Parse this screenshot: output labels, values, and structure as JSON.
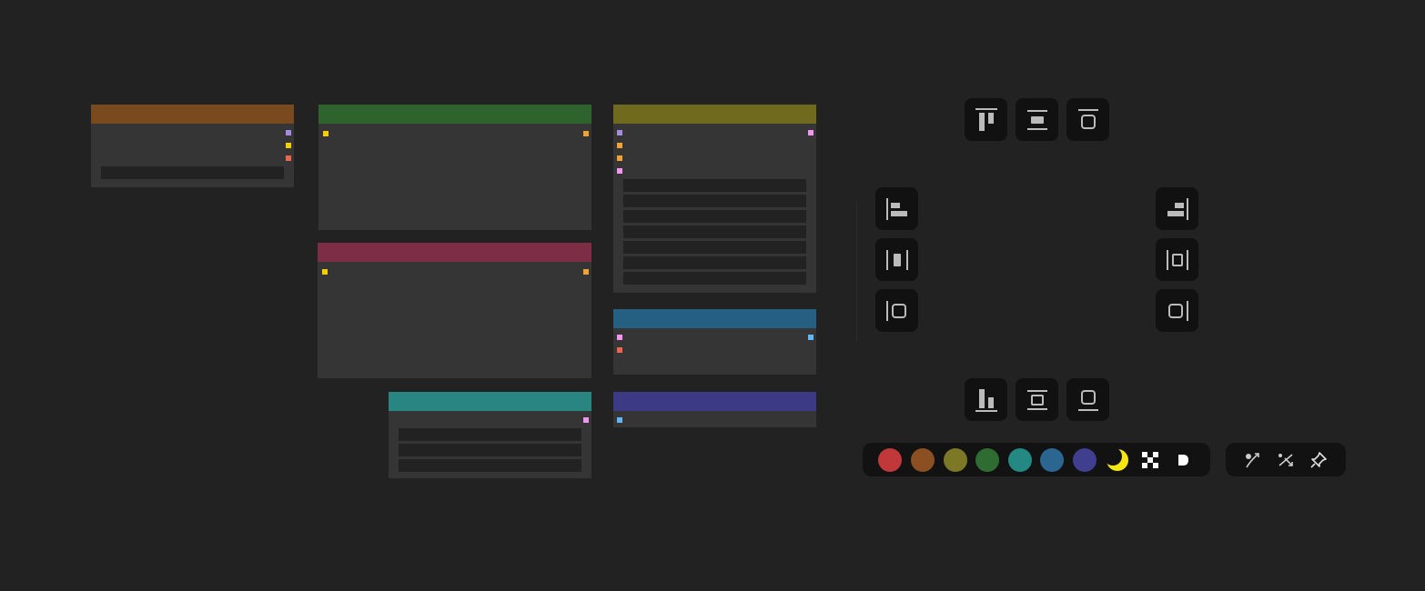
{
  "colors": {
    "background": "#222222",
    "node_body": "#353535",
    "widget": "#222222",
    "toolbar": "#111111"
  },
  "nodes": [
    {
      "name": "node-brown",
      "header_color": "#7a4a1f"
    },
    {
      "name": "node-green",
      "header_color": "#2e632d"
    },
    {
      "name": "node-red",
      "header_color": "#7e2d47"
    },
    {
      "name": "node-olive",
      "header_color": "#6f6a1e"
    },
    {
      "name": "node-blue",
      "header_color": "#255f82"
    },
    {
      "name": "node-teal",
      "header_color": "#298581"
    },
    {
      "name": "node-indigo",
      "header_color": "#3d3a85"
    }
  ],
  "slot_colors": {
    "lavender": "#a58ce0",
    "yellow": "#f5cd05",
    "orange": "#f0a232",
    "salmon": "#ea6650",
    "pink": "#f295f0",
    "skyblue": "#64b5f6"
  },
  "align_toolbar": {
    "top": [
      "align-top-icon",
      "align-vertical-center-icon",
      "align-top-edge-icon"
    ],
    "left": [
      "align-left-icon",
      "distribute-horizontal-icon",
      "align-left-edge-icon"
    ],
    "right": [
      "align-right-icon",
      "distribute-horizontal-alt-icon",
      "align-right-edge-icon"
    ],
    "bottom": [
      "align-bottom-icon",
      "align-middle-icon",
      "align-bottom-edge-icon"
    ]
  },
  "color_palette": [
    {
      "name": "red",
      "color": "#c0383a"
    },
    {
      "name": "brown",
      "color": "#8b4f22"
    },
    {
      "name": "olive",
      "color": "#7c7825"
    },
    {
      "name": "green",
      "color": "#2f6c31"
    },
    {
      "name": "teal",
      "color": "#248983"
    },
    {
      "name": "blue",
      "color": "#2a6690"
    },
    {
      "name": "indigo",
      "color": "#403e8e"
    }
  ],
  "palette_extras": [
    "moon-icon",
    "transparency-checker-icon",
    "arrow-right-icon"
  ],
  "link_tools": [
    "spline-link-icon",
    "straight-link-icon",
    "pin-icon"
  ]
}
